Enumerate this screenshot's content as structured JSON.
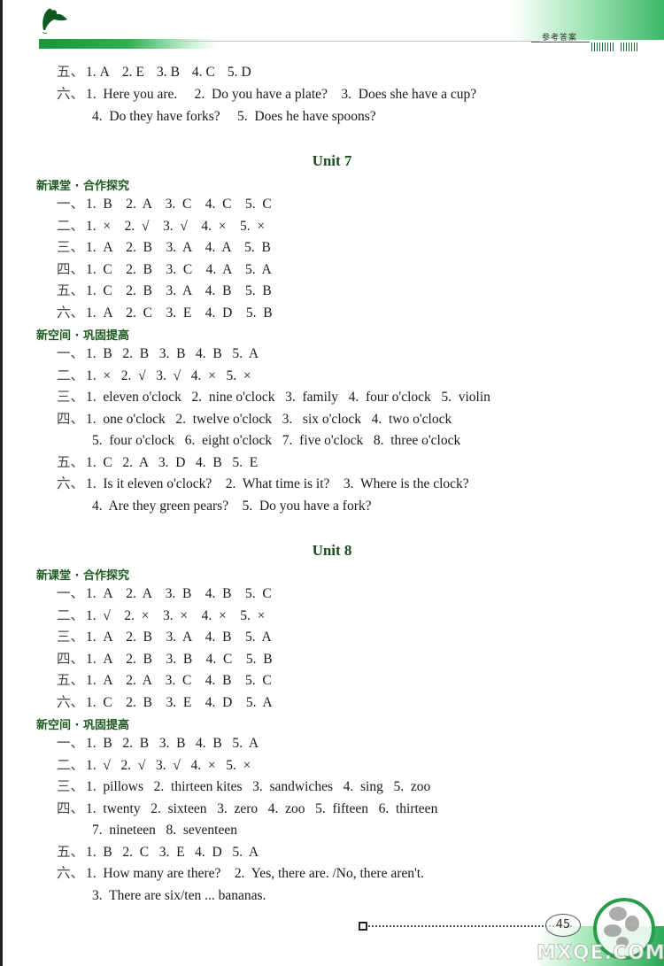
{
  "header": {
    "title": "参考答案"
  },
  "top_continuation": [
    {
      "prefix": "五、",
      "items": [
        [
          "1.",
          "A"
        ],
        [
          "2.",
          "E"
        ],
        [
          "3.",
          "B"
        ],
        [
          "4.",
          "C"
        ],
        [
          "5.",
          "D"
        ]
      ]
    },
    {
      "prefix": "六、",
      "lines": [
        "1.  Here you are.     2.  Do you have a plate?    3.  Does she have a cup?",
        "4.  Do they have forks?     5.  Does he have spoons?"
      ]
    }
  ],
  "units": [
    {
      "title": "Unit 7",
      "sections": [
        {
          "label": "新课堂 · 合作探究",
          "rows": [
            {
              "prefix": "一、",
              "text": "1.  B    2.  A    3.  C    4.  C    5.  C"
            },
            {
              "prefix": "二、",
              "text": "1.  ×    2.  √    3.  √    4.  ×    5.  ×"
            },
            {
              "prefix": "三、",
              "text": "1.  A    2.  B    3.  A    4.  A    5.  B"
            },
            {
              "prefix": "四、",
              "text": "1.  C    2.  B    3.  C    4.  A    5.  A"
            },
            {
              "prefix": "五、",
              "text": "1.  C    2.  B    3.  A    4.  B    5.  B"
            },
            {
              "prefix": "六、",
              "text": "1.  A    2.  C    3.  E    4.  D    5.  B"
            }
          ]
        },
        {
          "label": "新空间 · 巩固提高",
          "rows": [
            {
              "prefix": "一、",
              "text": "1.  B   2.  B   3.  B   4.  B   5.  A"
            },
            {
              "prefix": "二、",
              "text": "1.  ×   2.  √   3.  √   4.  ×   5.  ×"
            },
            {
              "prefix": "三、",
              "text": "1.  eleven o'clock   2.  nine o'clock   3.  family   4.  four o'clock   5.  violin"
            },
            {
              "prefix": "四、",
              "text": "1.  one o'clock   2.  twelve o'clock   3.   six o'clock   4.  two o'clock"
            },
            {
              "prefix": "",
              "text": "5.  four o'clock   6.  eight o'clock   7.  five o'clock   8.  three o'clock"
            },
            {
              "prefix": "五、",
              "text": "1.  C   2.  A   3.  D   4.  B   5.  E"
            },
            {
              "prefix": "六、",
              "text": "1.  Is it eleven o'clock?    2.  What time is it?    3.  Where is the clock?"
            },
            {
              "prefix": "",
              "text": "4.  Are they green pears?    5.  Do you have a fork?"
            }
          ]
        }
      ]
    },
    {
      "title": "Unit 8",
      "sections": [
        {
          "label": "新课堂 · 合作探究",
          "rows": [
            {
              "prefix": "一、",
              "text": "1.  A    2.  A    3.  B    4.  B    5.  C"
            },
            {
              "prefix": "二、",
              "text": "1.  √    2.  ×    3.  ×    4.  ×    5.  ×"
            },
            {
              "prefix": "三、",
              "text": "1.  A    2.  B    3.  A    4.  B    5.  A"
            },
            {
              "prefix": "四、",
              "text": "1.  A    2.  B    3.  B    4.  C    5.  B"
            },
            {
              "prefix": "五、",
              "text": "1.  A    2.  A    3.  C    4.  B    5.  C"
            },
            {
              "prefix": "六、",
              "text": "1.  C    2.  B    3.  E    4.  D    5.  A"
            }
          ]
        },
        {
          "label": "新空间 · 巩固提高",
          "rows": [
            {
              "prefix": "一、",
              "text": "1.  B   2.  B   3.  B   4.  B   5.  A"
            },
            {
              "prefix": "二、",
              "text": "1.  √   2.  √   3.  √   4.  ×   5.  ×"
            },
            {
              "prefix": "三、",
              "text": "1.  pillows   2.  thirteen kites   3.  sandwiches   4.  sing   5.  zoo"
            },
            {
              "prefix": "四、",
              "text": "1.  twenty   2.  sixteen   3.  zero   4.  zoo   5.  fifteen   6.  thirteen"
            },
            {
              "prefix": "",
              "text": "7.  nineteen   8.  seventeen"
            },
            {
              "prefix": "五、",
              "text": "1.  B   2.  C   3.  E   4.  D   5.  A"
            },
            {
              "prefix": "六、",
              "text": "1.  How many are there?    2.  Yes, there are. /No, there aren't."
            },
            {
              "prefix": "",
              "text": "3.  There are six/ten ... bananas."
            }
          ]
        }
      ]
    }
  ],
  "footer": {
    "page_number": "45",
    "watermark": "MXQE.COM"
  },
  "colors": {
    "accent_green": "#2a9a4b",
    "heading_green": "#1c5a1e"
  }
}
